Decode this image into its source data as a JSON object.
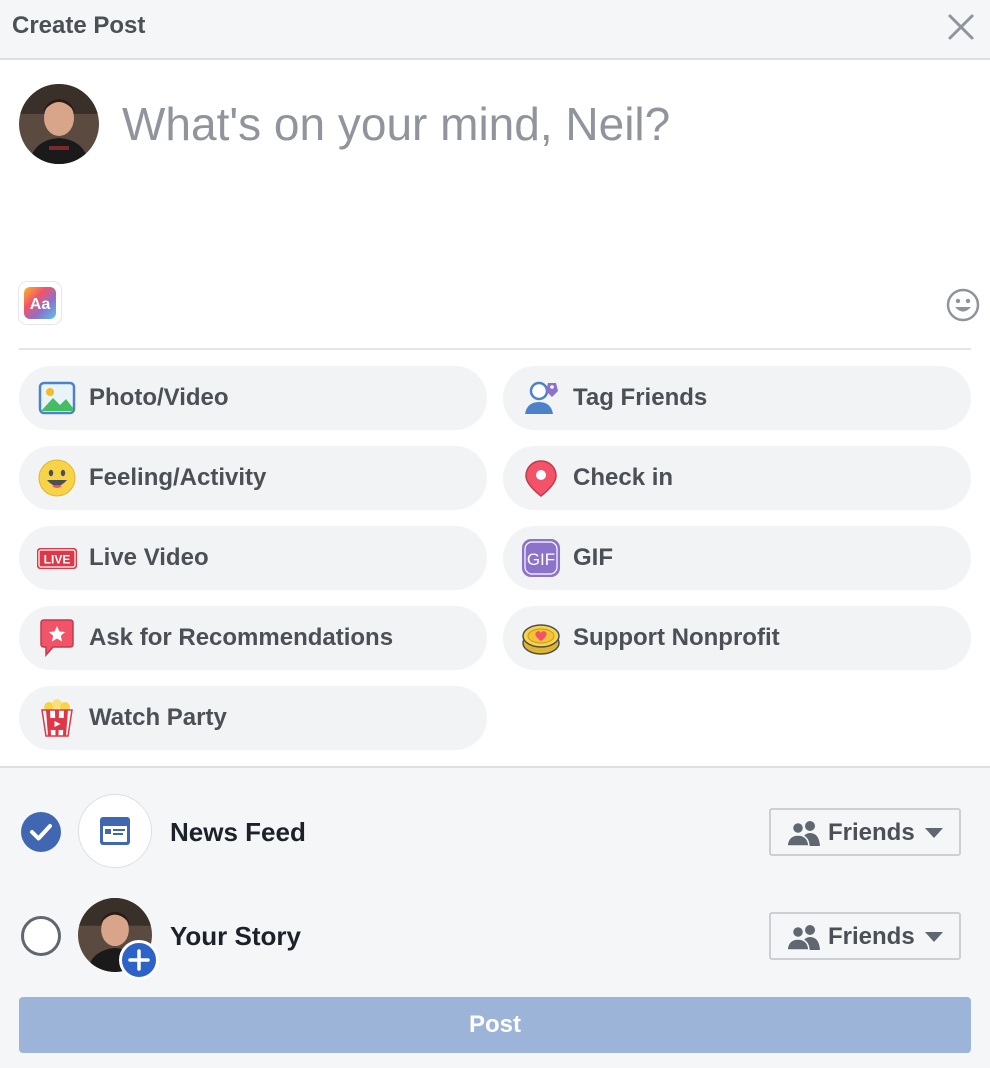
{
  "header": {
    "title": "Create Post"
  },
  "composer": {
    "placeholder": "What's on your mind, Neil?"
  },
  "options": [
    {
      "label": "Photo/Video",
      "icon": "photo-video-icon"
    },
    {
      "label": "Tag Friends",
      "icon": "tag-friends-icon"
    },
    {
      "label": "Feeling/Activity",
      "icon": "feeling-icon"
    },
    {
      "label": "Check in",
      "icon": "check-in-icon"
    },
    {
      "label": "Live Video",
      "icon": "live-video-icon",
      "badge": "LIVE"
    },
    {
      "label": "GIF",
      "icon": "gif-icon",
      "badge": "GIF"
    },
    {
      "label": "Ask for Recommendations",
      "icon": "recommendations-icon"
    },
    {
      "label": "Support Nonprofit",
      "icon": "nonprofit-icon"
    },
    {
      "label": "Watch Party",
      "icon": "watch-party-icon"
    }
  ],
  "destinations": [
    {
      "label": "News Feed",
      "checked": true,
      "audience": "Friends"
    },
    {
      "label": "Your Story",
      "checked": false,
      "audience": "Friends"
    }
  ],
  "post_button": {
    "label": "Post"
  },
  "colors": {
    "brand_blue": "#4267b2",
    "post_disabled": "#9cb4d8",
    "pill_bg": "#f2f3f5"
  }
}
